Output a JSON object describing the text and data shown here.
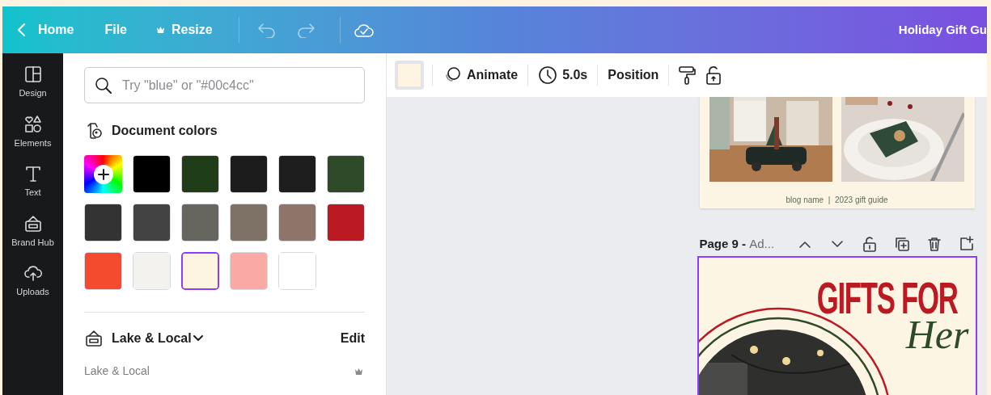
{
  "top_bar": {
    "back": {
      "label": "Home"
    },
    "menu": [
      {
        "kind": "plain",
        "label": "File"
      },
      {
        "kind": "premium",
        "label": "Resize"
      }
    ],
    "document_title": "Holiday Gift Gu"
  },
  "sidebar": {
    "items": [
      {
        "kind": "design",
        "label": "Design"
      },
      {
        "kind": "elements",
        "label": "Elements"
      },
      {
        "kind": "text",
        "label": "Text"
      },
      {
        "kind": "brand",
        "label": "Brand Hub"
      },
      {
        "kind": "uploads",
        "label": "Uploads"
      }
    ]
  },
  "color_panel": {
    "search": {
      "placeholder": "Try \"blue\" or \"#00c4cc\""
    },
    "document_colors": {
      "title": "Document colors",
      "swatches": [
        {
          "kind": "add",
          "selected": false
        },
        {
          "kind": "color",
          "color": "#000000",
          "selected": false
        },
        {
          "kind": "color",
          "color": "#1f3d17",
          "selected": false
        },
        {
          "kind": "color",
          "color": "#1c1c1c",
          "selected": false
        },
        {
          "kind": "color",
          "color": "#1e1e1e",
          "selected": false
        },
        {
          "kind": "color",
          "color": "#2e4a28",
          "selected": false
        },
        {
          "kind": "color",
          "color": "#333333",
          "selected": false
        },
        {
          "kind": "color",
          "color": "#434343",
          "selected": false
        },
        {
          "kind": "color",
          "color": "#66665e",
          "selected": false
        },
        {
          "kind": "color",
          "color": "#7d7265",
          "selected": false
        },
        {
          "kind": "color",
          "color": "#8f746a",
          "selected": false
        },
        {
          "kind": "color",
          "color": "#bb1a22",
          "selected": false
        },
        {
          "kind": "color",
          "color": "#f44a2e",
          "selected": false
        },
        {
          "kind": "color",
          "color": "#f3f2ef",
          "selected": false
        },
        {
          "kind": "color",
          "color": "#fdf5e2",
          "selected": true
        },
        {
          "kind": "color",
          "color": "#fba9a5",
          "selected": false
        },
        {
          "kind": "color",
          "color": "#ffffff",
          "selected": false
        }
      ]
    },
    "brand_kit": {
      "name": "Lake & Local",
      "action": "Edit",
      "subsection": "Lake & Local"
    }
  },
  "toolbar": {
    "fill_swatch": {
      "color": "#fdf5e2"
    },
    "items": [
      {
        "kind": "animate",
        "label": "Animate"
      },
      {
        "kind": "duration",
        "label": "5.0s"
      },
      {
        "kind": "plain",
        "label": "Position"
      }
    ]
  },
  "pages": [
    {
      "footer": "blog name  |  2023 gift guide"
    },
    {
      "label": "Page 9 - ",
      "title": "Ad...",
      "heading": "GIFTS FOR",
      "script": "Her",
      "selected": true
    }
  ]
}
